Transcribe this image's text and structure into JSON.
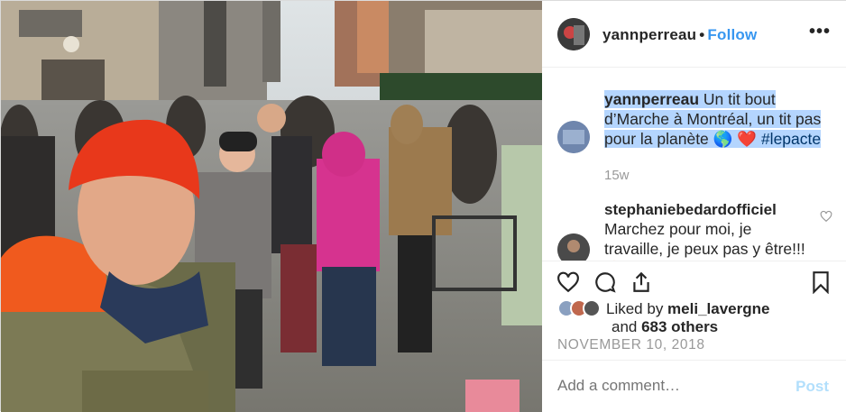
{
  "post": {
    "username": "yannperreau",
    "separator": "•",
    "follow_label": "Follow",
    "more_label": "•••"
  },
  "caption": {
    "username": "yannperreau",
    "text": " Un tit bout d’Marche à Montréal, un tit pas pour la planète 🌎 ❤️ ",
    "hashtag": "#lepacte",
    "time": "15w"
  },
  "comments": [
    {
      "username": "stephaniebedardofficiel",
      "text": "Marchez pour moi, je travaille, je peux pas y être!!! 😩"
    }
  ],
  "likes": {
    "prefix": "Liked by ",
    "user": "meli_lavergne",
    "middle": "and ",
    "count_text": "683 others"
  },
  "date": "NOVEMBER 10, 2018",
  "add_comment": {
    "placeholder": "Add a comment…",
    "post_label": "Post"
  },
  "colors": {
    "follow": "#3897f0",
    "post_disabled": "#b2dffc",
    "highlight": "#b4d5fe",
    "muted": "#999999"
  },
  "icons": [
    "more-icon",
    "heart-icon",
    "comment-icon",
    "share-icon",
    "bookmark-icon",
    "small-heart-icon"
  ]
}
